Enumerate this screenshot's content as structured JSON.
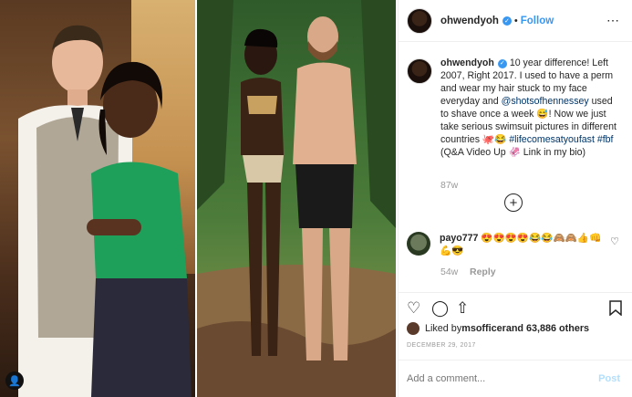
{
  "post": {
    "username": "ohwendyoh",
    "follow_label": "Follow",
    "more_icon": "⋯",
    "caption": {
      "text_1": "10 year difference! Left 2007, Right 2017. I used to have a perm and wear my hair stuck to my face everyday and ",
      "mention": "@shotsofhennessey",
      "text_2": " used to shave once a week 😅! Now we just take serious swimsuit pictures in different countries 🐙😂 ",
      "hashtags": "#lifecomesatyoufast #fbf",
      "text_3": " (Q&A Video Up 🦑 Link in my bio)"
    },
    "caption_time": "87w",
    "load_more_icon": "+",
    "comment": {
      "username": "payo777",
      "text": "😍😍😍😍😂😂🙈🙈👍👊💪😎",
      "time": "54w",
      "reply_label": "Reply"
    },
    "likes": {
      "prefix": "Liked by ",
      "user": "msofficer",
      "suffix": " and 63,886 others"
    },
    "date": "DECEMBER 29, 2017",
    "add_comment_placeholder": "Add a comment...",
    "post_label": "Post"
  },
  "icons": {
    "user_badge": "👤",
    "heart": "♡",
    "comment": "◯",
    "share": "⇧",
    "bookmark": "🔖"
  },
  "colors": {
    "link_blue": "#3897f0",
    "text": "#262626",
    "muted": "#999999",
    "post_disabled": "#b2dffc"
  }
}
